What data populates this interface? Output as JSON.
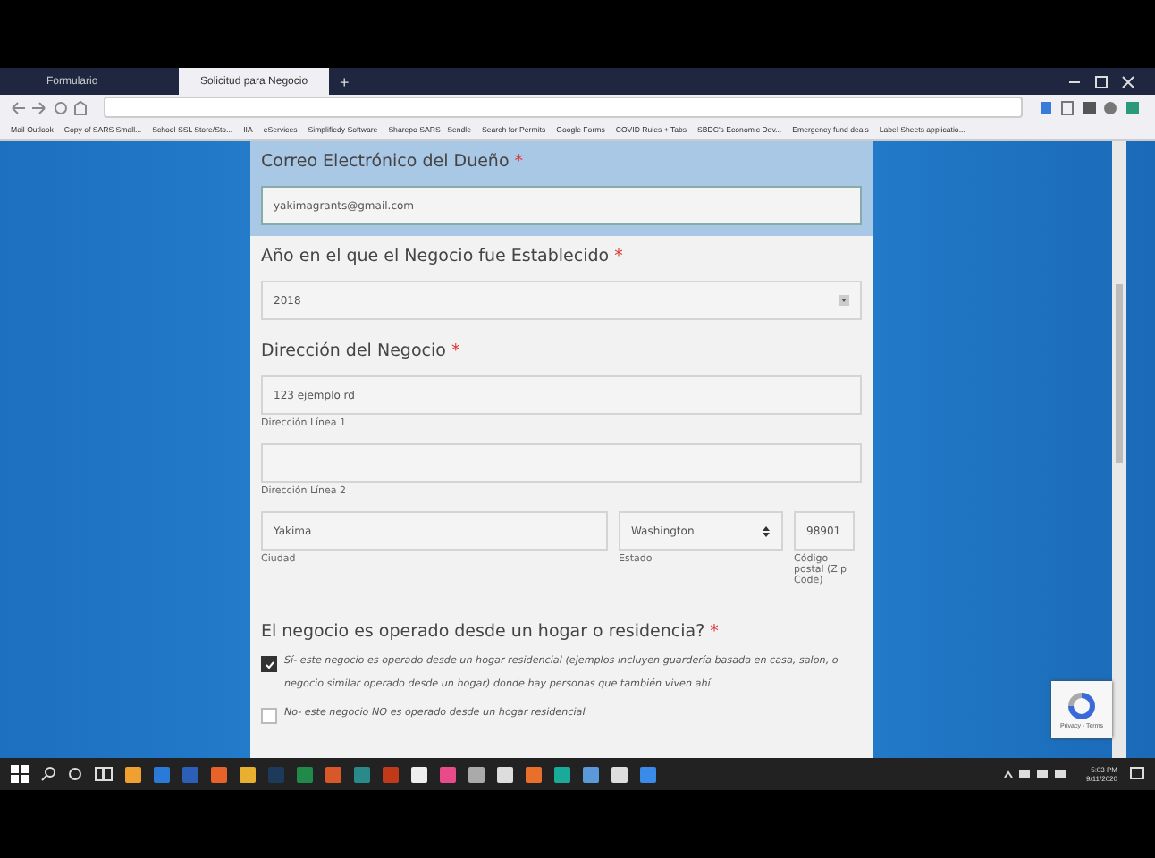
{
  "browser": {
    "tabs": [
      {
        "label": "Formulario",
        "selected": false
      },
      {
        "label": "Solicitud para Negocio",
        "selected": true
      }
    ],
    "new_tab": "+",
    "bookmarks": [
      "Mail Outlook",
      "Copy of SARS Small...",
      "School SSL Store/Sto...",
      "IIA",
      "eServices",
      "Simplifiedy Software",
      "Sharepo SARS - Sendle",
      "Search for Permits",
      "Google Forms",
      "COVID Rules + Tabs",
      "SBDC's Economic Dev...",
      "Emergency fund deals",
      "Label Sheets applicatio..."
    ]
  },
  "form": {
    "email": {
      "label": "Correo Electrónico del Dueño",
      "mark": "*",
      "value": "yakimagrants@gmail.com",
      "highlighted": true
    },
    "year": {
      "label": "Año en el que el Negocio fue Establecido",
      "mark": "*",
      "value": "2018"
    },
    "address": {
      "label": "Dirección del Negocio",
      "mark": "*",
      "line1": {
        "value": "123 ejemplo rd",
        "caption": "Dirección Línea 1"
      },
      "line2": {
        "caption": "Dirección Línea 2"
      },
      "city": {
        "value": "Yakima",
        "caption": "Ciudad"
      },
      "state": {
        "value": "Washington",
        "caption": "Estado"
      },
      "zip": {
        "value": "98901",
        "caption": "Código postal (Zip Code)"
      }
    },
    "home": {
      "label": "El negocio es operado desde un hogar o residencia?",
      "mark": "*",
      "options": [
        {
          "text": "Sí- este negocio es operado desde un hogar residencial (ejemplos incluyen guardería basada en casa, salon, o negocio similar operado desde un hogar) donde hay personas que también viven ahí",
          "checked": true
        },
        {
          "text": "No- este negocio NO es operado desde un hogar residencial",
          "checked": false
        }
      ]
    }
  },
  "recaptcha": {
    "links": "Privacy - Terms"
  },
  "taskbar": {
    "time": "5:03 PM",
    "date": "9/11/2020"
  }
}
